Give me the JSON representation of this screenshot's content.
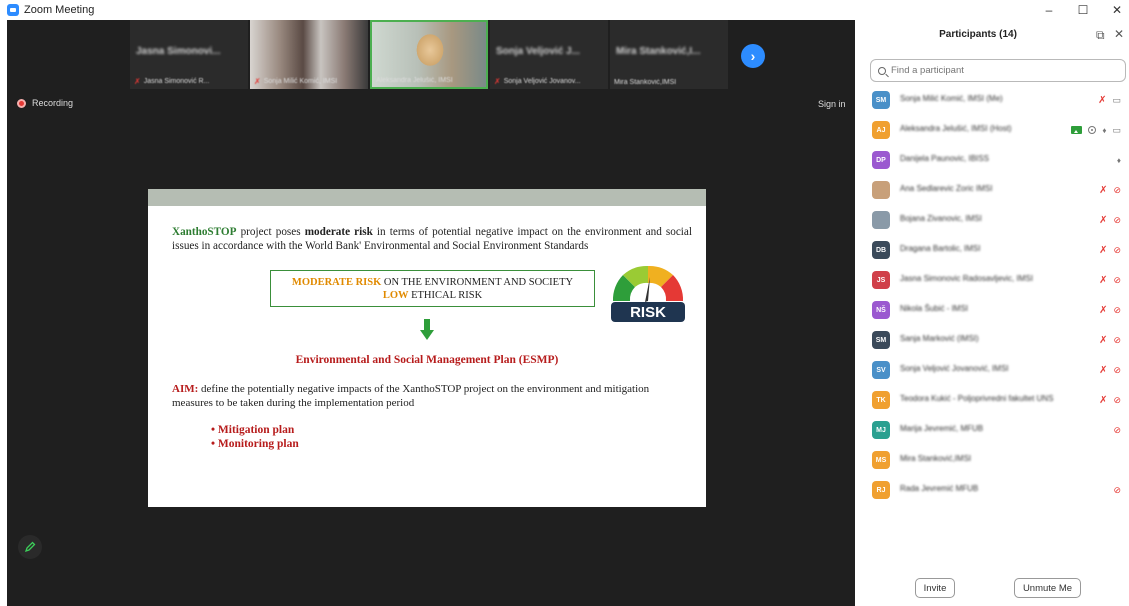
{
  "window": {
    "title": "Zoom Meeting",
    "controls": [
      "–",
      "☐",
      "✕"
    ]
  },
  "meeting": {
    "thumbnails": [
      {
        "name": "Jasna Simonovi...",
        "label": "Jasna Simonović R...",
        "muted": true,
        "has_video": false
      },
      {
        "name": "",
        "label": "Sonja Milić Komić, IMSI",
        "muted": true,
        "has_video": true
      },
      {
        "name": "",
        "label": "Aleksandra Jelušić, IMSI",
        "muted": false,
        "has_video": true
      },
      {
        "name": "Sonja Veljović J...",
        "label": "Sonja Veljović Jovanov...",
        "muted": true,
        "has_video": false
      },
      {
        "name": "Mira Stanković,I...",
        "label": "Mira Stanković,IMSI",
        "muted": false,
        "has_video": false
      }
    ],
    "next_icon": "chevron-right-icon",
    "recording_label": "Recording",
    "signin_label": "Sign in"
  },
  "slide": {
    "p1_name": "XanthoSTOP",
    "p1_text1": " project poses ",
    "p1_bold": "moderate risk",
    "p1_text2": " in terms of potential negative impact on the environment and social issues in accordance with the World Bank' Environmental and Social Environment Standards",
    "box_line1_colored": "MODERATE RISK",
    "box_line1_rest": "  ON THE ENVIRONMENT AND SOCIETY",
    "box_line2_colored": "LOW",
    "box_line2_rest": " ETHICAL RISK",
    "gauge_label": "RISK",
    "gauge_scale": [
      "LOW",
      "MEDIUM",
      "HIGH"
    ],
    "esmp_title": "Environmental and Social Management Plan (ESMP)",
    "aim_label": "AIM:",
    "aim_text": " define the potentially negative impacts of the XanthoSTOP project on the environment and mitigation measures to be taken during the implementation period",
    "bullets": [
      "Mitigation plan",
      "Monitoring plan"
    ]
  },
  "participants": {
    "title": "Participants (14)",
    "search_placeholder": "Find a participant",
    "list": [
      {
        "initials": "SM",
        "color": "#4a90c8",
        "name": "Sonja Milić Komić, IMSI (Me)",
        "icons": [
          "muted-mic",
          "video"
        ]
      },
      {
        "initials": "AJ",
        "color": "#f0a030",
        "name": "Aleksandra Jelušić, IMSI (Host)",
        "icons": [
          "share",
          "rec",
          "mic",
          "video"
        ]
      },
      {
        "initials": "DP",
        "color": "#9b59d0",
        "name": "Danijela Paunovic, IBISS",
        "icons": [
          "mic"
        ]
      },
      {
        "initials": "",
        "color": "#c8a07a",
        "name": "Ana Sedlarevic Zoric IMSI",
        "icons": [
          "muted-mic",
          "video-off"
        ]
      },
      {
        "initials": "",
        "color": "#8a9aa8",
        "name": "Bojana Zivanovic, IMSI",
        "icons": [
          "muted-mic",
          "video-off"
        ]
      },
      {
        "initials": "DB",
        "color": "#3b4a5a",
        "name": "Dragana Bartolic, IMSI",
        "icons": [
          "muted-mic",
          "video-off"
        ]
      },
      {
        "initials": "JS",
        "color": "#d0404a",
        "name": "Jasna Simonovic Radosavljevic, IMSI",
        "icons": [
          "muted-mic",
          "video-off"
        ]
      },
      {
        "initials": "NŠ",
        "color": "#9b59d0",
        "name": "Nikola Šubić - IMSI",
        "icons": [
          "muted-mic",
          "video-off"
        ]
      },
      {
        "initials": "SM",
        "color": "#3b4a5a",
        "name": "Sanja Marković (IMSI)",
        "icons": [
          "muted-mic",
          "video-off"
        ]
      },
      {
        "initials": "SV",
        "color": "#4a90c8",
        "name": "Sonja Veljović Jovanović, IMSI",
        "icons": [
          "muted-mic",
          "video-off"
        ]
      },
      {
        "initials": "TK",
        "color": "#f0a030",
        "name": "Teodora Kukić - Poljoprivredni fakultet UNS",
        "icons": [
          "muted-mic",
          "video-off"
        ]
      },
      {
        "initials": "MJ",
        "color": "#2aa090",
        "name": "Marija Jevremić, MFUB",
        "icons": [
          "video-off"
        ]
      },
      {
        "initials": "MS",
        "color": "#f0a030",
        "name": "Mira Stanković,IMSI",
        "icons": []
      },
      {
        "initials": "RJ",
        "color": "#f0a030",
        "name": "Rada Jevremić MFUB",
        "icons": [
          "video-off"
        ]
      }
    ],
    "invite_label": "Invite",
    "unmute_label": "Unmute Me"
  }
}
